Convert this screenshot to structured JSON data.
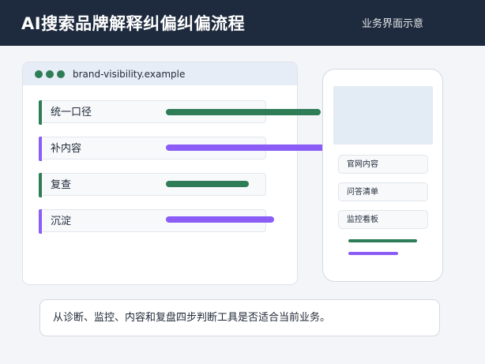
{
  "header": {
    "title": "AI搜索品牌解释纠偏纠偏流程",
    "subtitle": "业务界面示意"
  },
  "browser": {
    "url": "brand-visibility.example",
    "steps": [
      {
        "label": "统一口径",
        "progress": 0.56,
        "color": "#2e7d57"
      },
      {
        "label": "补内容",
        "progress": 0.66,
        "color": "#8b5cf6"
      },
      {
        "label": "复查",
        "progress": 0.3,
        "color": "#2e7d57"
      },
      {
        "label": "沉淀",
        "progress": 0.39,
        "color": "#8b5cf6"
      }
    ]
  },
  "phone": {
    "rows": [
      {
        "label": "官网内容"
      },
      {
        "label": "问答清单"
      },
      {
        "label": "监控看板"
      }
    ],
    "lines": [
      {
        "color": "#2e7d57",
        "progress": 0.58
      },
      {
        "color": "#8b5cf6",
        "progress": 0.42
      }
    ]
  },
  "caption": {
    "text": "从诊断、监控、内容和复盘四步判断工具是否适合当前业务。"
  },
  "colors": {
    "header_bg": "#1e2a3d",
    "green": "#2e7d57",
    "purple": "#8b5cf6",
    "browser_bar": "#e6edf6"
  }
}
